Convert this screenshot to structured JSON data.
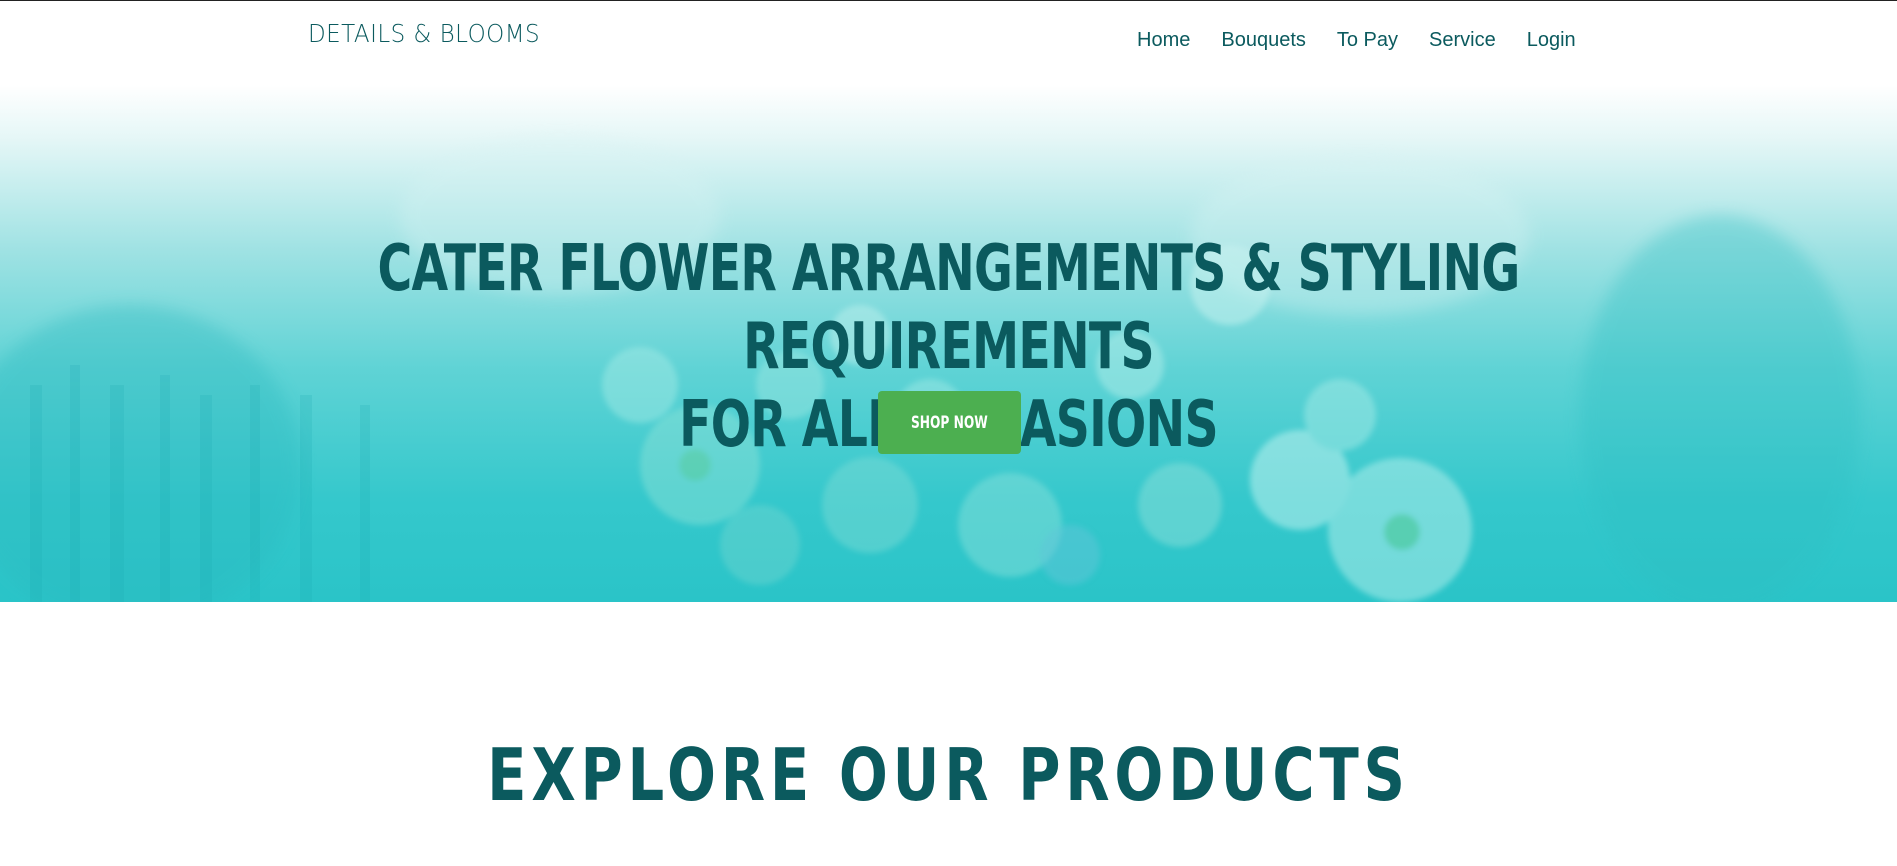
{
  "header": {
    "logo": "DETAILS & BLOOMS",
    "nav": [
      {
        "label": "Home"
      },
      {
        "label": "Bouquets"
      },
      {
        "label": "To Pay"
      },
      {
        "label": "Service"
      },
      {
        "label": "Login"
      }
    ]
  },
  "hero": {
    "title_line1": "CATER FLOWER ARRANGEMENTS & STYLING REQUIREMENTS",
    "title_line2": "FOR ALL OCCASIONS",
    "cta_label": "SHOP NOW"
  },
  "products": {
    "title": "EXPLORE OUR PRODUCTS"
  },
  "colors": {
    "brand_text": "#0b5a5e",
    "hero_teal": "#2ac4c8",
    "button_green": "#4caf50",
    "background": "#ffffff"
  }
}
